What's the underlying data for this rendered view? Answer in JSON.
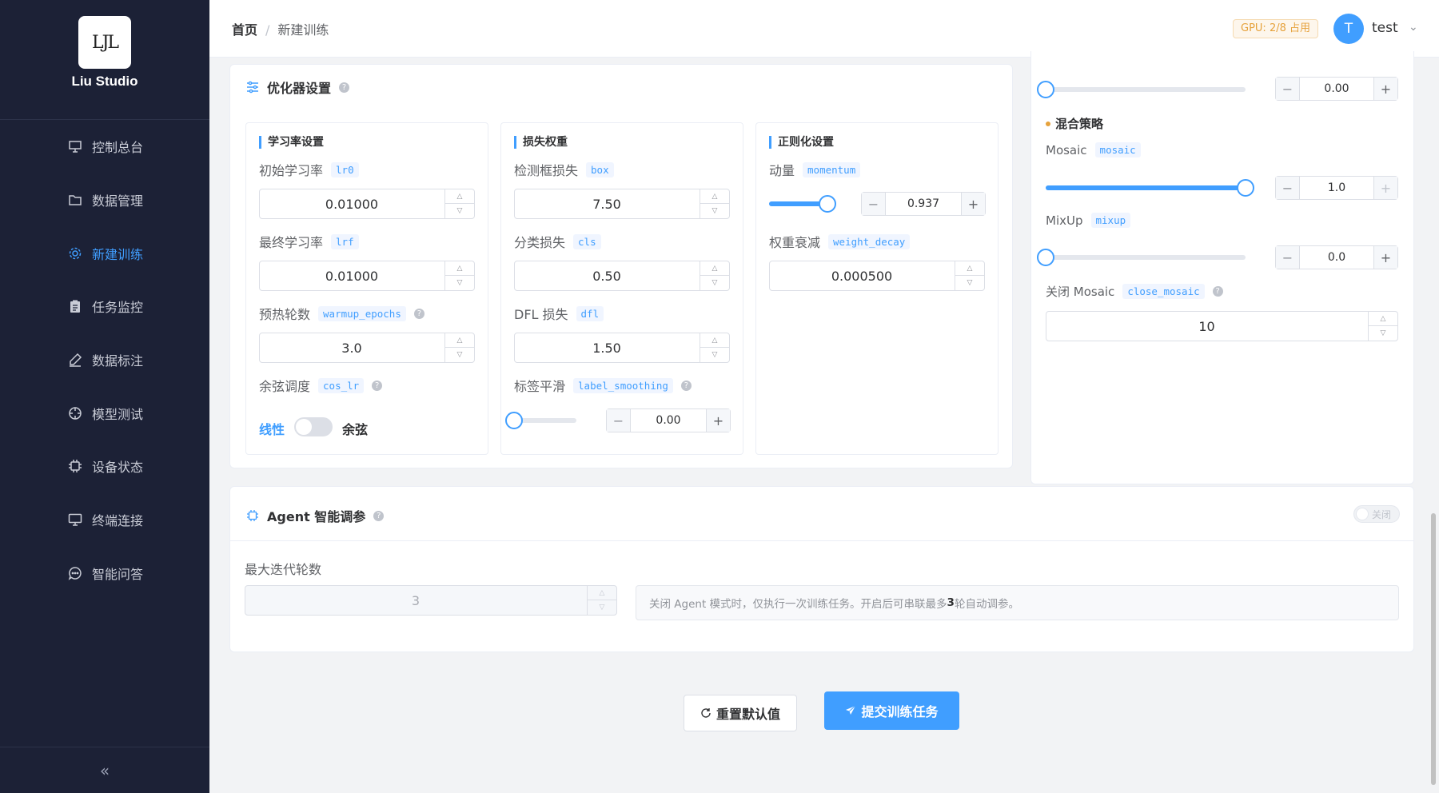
{
  "app": {
    "title": "Liu Studio",
    "logo_text": "LJL"
  },
  "sidebar": {
    "items": [
      {
        "label": "控制总台",
        "icon": "presentation-icon"
      },
      {
        "label": "数据管理",
        "icon": "folder-icon"
      },
      {
        "label": "新建训练",
        "icon": "gear-icon",
        "active": true
      },
      {
        "label": "任务监控",
        "icon": "clipboard-icon"
      },
      {
        "label": "数据标注",
        "icon": "pen-icon"
      },
      {
        "label": "模型测试",
        "icon": "target-icon"
      },
      {
        "label": "设备状态",
        "icon": "cpu-icon"
      },
      {
        "label": "终端连接",
        "icon": "monitor-icon"
      },
      {
        "label": "智能问答",
        "icon": "chat-icon"
      }
    ],
    "collapse_label": "«"
  },
  "header": {
    "breadcrumb": {
      "home": "首页",
      "separator": "/",
      "current": "新建训练"
    },
    "gpu_badge": "GPU: 2/8 占用",
    "user": {
      "avatar": "T",
      "name": "test"
    }
  },
  "optimizer": {
    "title": "优化器设置",
    "lr": {
      "title": "学习率设置",
      "lr0": {
        "label": "初始学习率",
        "key": "lr0",
        "value": "0.01000"
      },
      "lrf": {
        "label": "最终学习率",
        "key": "lrf",
        "value": "0.01000"
      },
      "warmup": {
        "label": "预热轮数",
        "key": "warmup_epochs",
        "value": "3.0"
      },
      "cos": {
        "label": "余弦调度",
        "key": "cos_lr",
        "off_label": "线性",
        "on_label": "余弦",
        "enabled": false
      }
    },
    "loss": {
      "title": "损失权重",
      "box": {
        "label": "检测框损失",
        "key": "box",
        "value": "7.50"
      },
      "cls": {
        "label": "分类损失",
        "key": "cls",
        "value": "0.50"
      },
      "dfl": {
        "label": "DFL 损失",
        "key": "dfl",
        "value": "1.50"
      },
      "smooth": {
        "label": "标签平滑",
        "key": "label_smoothing",
        "value": "0.00",
        "fraction": 0
      }
    },
    "reg": {
      "title": "正则化设置",
      "momentum": {
        "label": "动量",
        "key": "momentum",
        "value": "0.937",
        "fraction": 0.937
      },
      "decay": {
        "label": "权重衰减",
        "key": "weight_decay",
        "value": "0.000500"
      }
    }
  },
  "augment": {
    "top_value": "0.00",
    "mix_title": "混合策略",
    "mosaic": {
      "label": "Mosaic",
      "key": "mosaic",
      "value": "1.0",
      "fraction": 1.0
    },
    "mixup": {
      "label": "MixUp",
      "key": "mixup",
      "value": "0.0",
      "fraction": 0
    },
    "close_mosaic": {
      "label": "关闭 Mosaic",
      "key": "close_mosaic",
      "value": "10"
    }
  },
  "agent": {
    "title": "Agent 智能调参",
    "switch_label": "关闭",
    "max_iter_label": "最大迭代轮数",
    "max_iter_value": "3",
    "hint_pre": "关闭 Agent 模式时，仅执行一次训练任务。开启后可串联最多",
    "hint_num": "3",
    "hint_post": "轮自动调参。"
  },
  "actions": {
    "reset": "重置默认值",
    "submit": "提交训练任务"
  },
  "colors": {
    "primary": "#409eff",
    "sidebar_bg": "#1c2136",
    "warning": "#e6a23c"
  }
}
